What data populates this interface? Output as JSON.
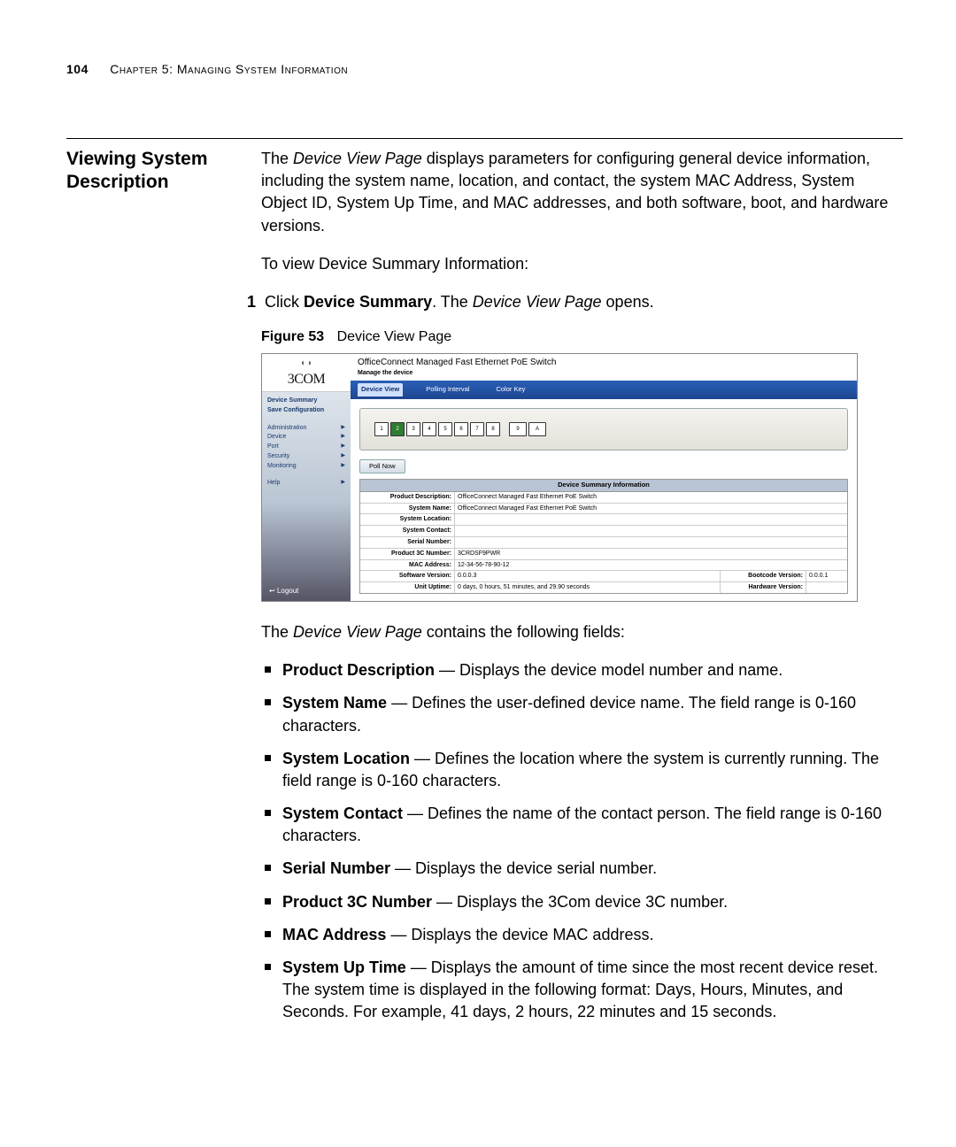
{
  "page_number": "104",
  "chapter_head": "Chapter 5: Managing System Information",
  "section_title": "Viewing System Description",
  "intro_para": "The Device View Page displays parameters for configuring general device information, including the system name, location, and contact, the system MAC Address, System Object ID, System Up Time, and MAC addresses, and both software, boot, and hardware versions.",
  "lead_in": "To view Device Summary Information:",
  "step1_pre": "Click ",
  "step1_bold": "Device Summary",
  "step1_post": ". The Device View Page opens.",
  "figure_label": "Figure 53",
  "figure_caption": "Device View Page",
  "screenshot": {
    "brand": "3COM",
    "title": "OfficeConnect Managed Fast Ethernet PoE Switch",
    "subtitle": "Manage the device",
    "tabs": [
      "Device View",
      "Polling Interval",
      "Color Key"
    ],
    "nav_top": [
      "Device Summary",
      "Save Configuration"
    ],
    "nav_mid": [
      "Administration",
      "Device",
      "Port",
      "Security",
      "Monitoring"
    ],
    "nav_help": "Help",
    "logout": "Logout",
    "poll_now": "Poll Now",
    "ports": [
      "1",
      "2",
      "3",
      "4",
      "5",
      "6",
      "7",
      "8",
      "9",
      "A"
    ],
    "table_title": "Device Summary Information",
    "rows": [
      {
        "k": "Product Description:",
        "v": "OfficeConnect Managed Fast Ethernet PoE Switch"
      },
      {
        "k": "System Name:",
        "v": "OfficeConnect Managed Fast Ethernet PoE Switch"
      },
      {
        "k": "System Location:",
        "v": ""
      },
      {
        "k": "System Contact:",
        "v": ""
      },
      {
        "k": "Serial Number:",
        "v": ""
      },
      {
        "k": "Product 3C Number:",
        "v": "3CRDSF9PWR"
      },
      {
        "k": "MAC Address:",
        "v": "12-34-56-78-90-12"
      }
    ],
    "sw_row": {
      "k": "Software Version:",
      "v": "0.0.0.3",
      "k2": "Bootcode Version:",
      "v2": "0.0.0.1"
    },
    "up_row": {
      "k": "Unit Uptime:",
      "v": "0 days, 0 hours, 51 minutes, and 29.90 seconds",
      "k2": "Hardware Version:",
      "v2": ""
    }
  },
  "after_fig": "The Device View Page contains the following fields:",
  "fields": [
    {
      "b": "Product Description",
      "t": " — Displays the device model number and name."
    },
    {
      "b": "System Name",
      "t": " — Defines the user-defined device name. The field range is 0-160 characters."
    },
    {
      "b": "System Location",
      "t": " — Defines the location where the system is currently running. The field range is 0-160 characters."
    },
    {
      "b": "System Contact",
      "t": " — Defines the name of the contact person. The field range is 0-160 characters."
    },
    {
      "b": "Serial Number",
      "t": " — Displays the device serial number."
    },
    {
      "b": "Product 3C Number",
      "t": " — Displays the 3Com device 3C number."
    },
    {
      "b": "MAC Address",
      "t": " — Displays the device MAC address."
    },
    {
      "b": "System Up Time",
      "t": " — Displays the amount of time since the most recent device reset. The system time is displayed in the following format: Days, Hours, Minutes, and Seconds. For example, 41 days, 2 hours, 22 minutes and 15 seconds."
    }
  ]
}
